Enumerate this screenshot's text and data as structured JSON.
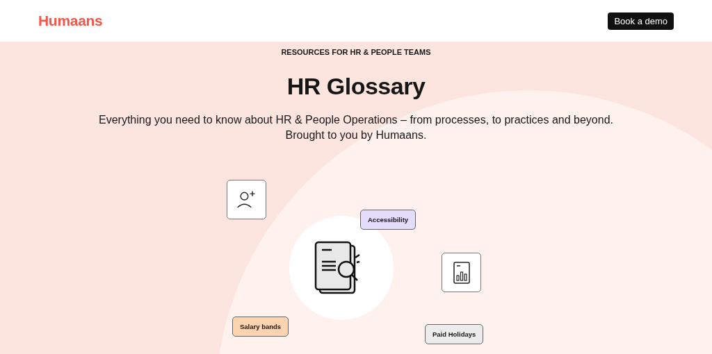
{
  "header": {
    "logo": "Humaans",
    "button": "Book a demo"
  },
  "hero": {
    "eyebrow": "RESOURCES FOR HR & PEOPLE TEAMS",
    "title": "HR Glossary",
    "subtitle_lines": [
      "Everything you need to know about HR & People Operations – from processes, to practices and beyond.",
      "Brought to you by Humaans."
    ]
  },
  "illustration": {
    "tags": [
      {
        "label": "Accessibility",
        "color": "#e3dcfb"
      },
      {
        "label": "Salary bands",
        "color": "#fdd3b0"
      },
      {
        "label": "Paid Holidays",
        "color": "#ececec"
      }
    ]
  }
}
